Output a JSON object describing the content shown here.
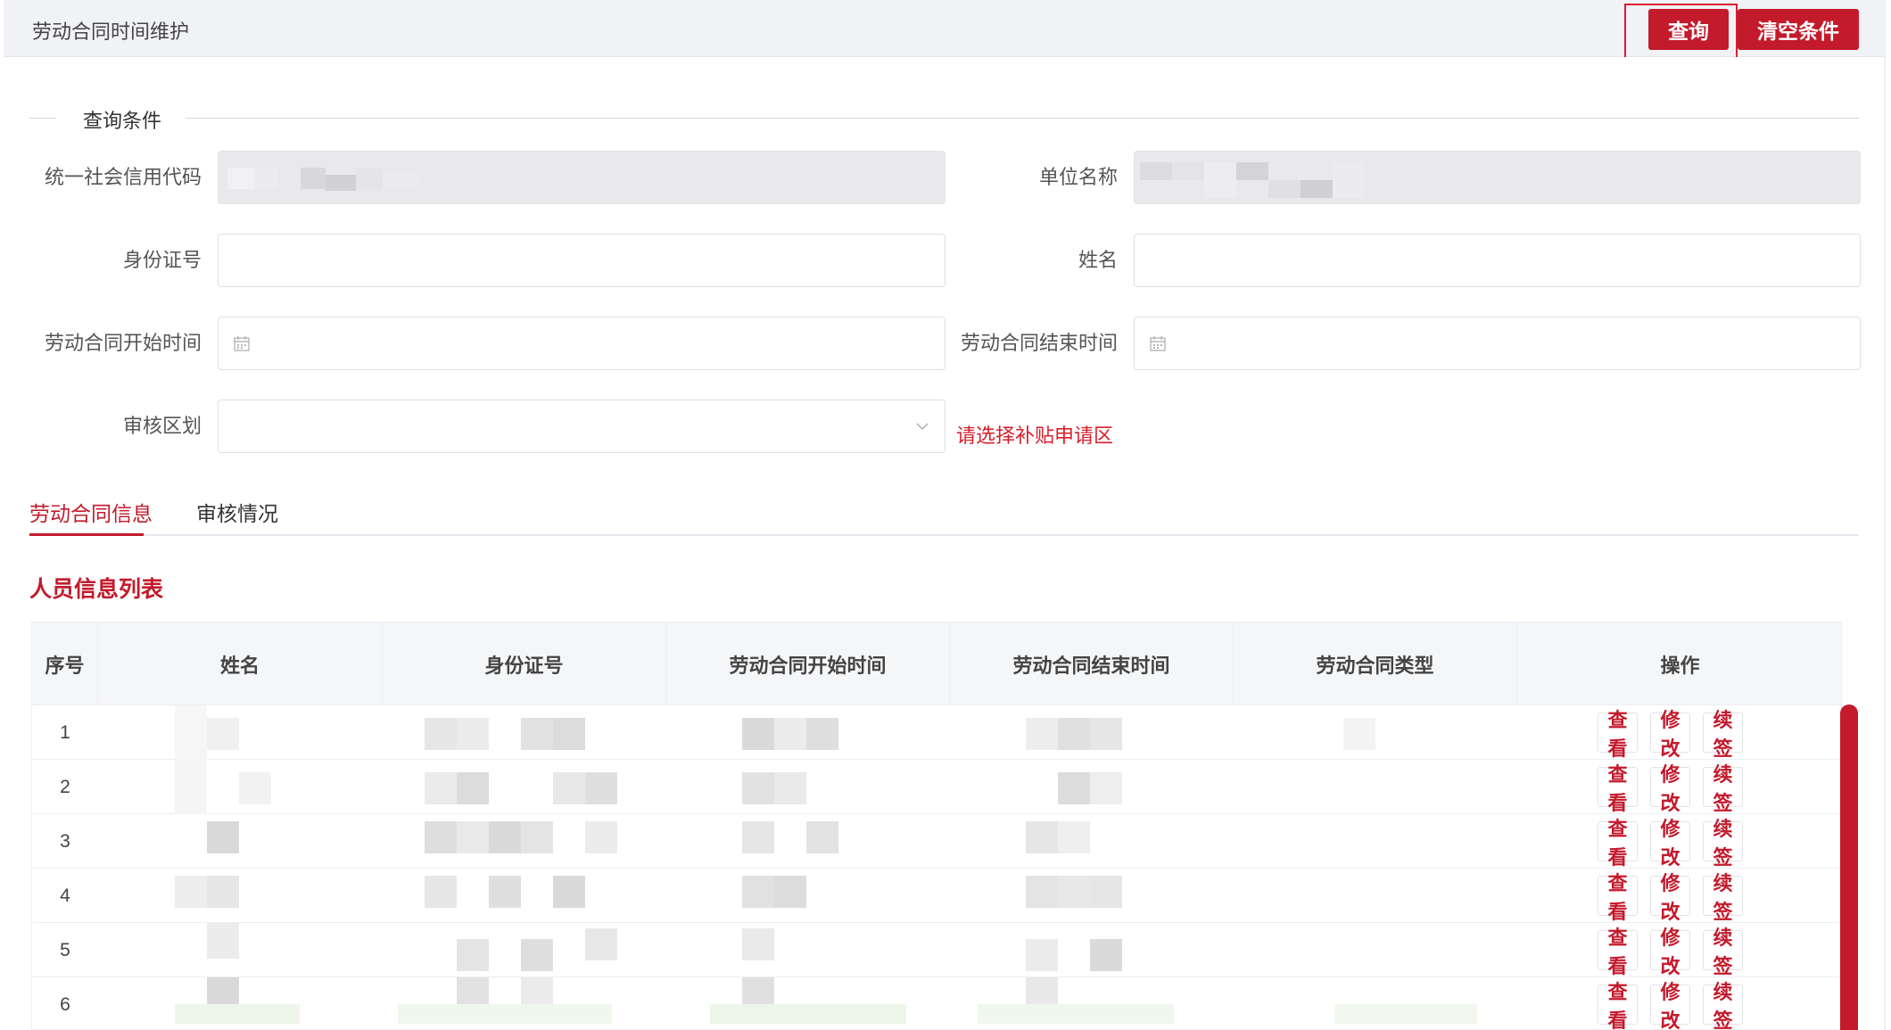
{
  "header": {
    "title": "劳动合同时间维护",
    "query_button": "查询",
    "clear_button": "清空条件"
  },
  "query": {
    "legend": "查询条件",
    "fields": {
      "credit_code_label": "统一社会信用代码",
      "unit_name_label": "单位名称",
      "id_number_label": "身份证号",
      "name_label": "姓名",
      "start_time_label": "劳动合同开始时间",
      "end_time_label": "劳动合同结束时间",
      "region_label": "审核区划",
      "region_hint": "请选择补贴申请区"
    },
    "icons": {
      "calendar": "calendar-icon",
      "select": "chevron-down-icon"
    }
  },
  "tabs": [
    {
      "label": "劳动合同信息",
      "active": true
    },
    {
      "label": "审核情况",
      "active": false
    }
  ],
  "list": {
    "title": "人员信息列表",
    "columns": [
      "序号",
      "姓名",
      "身份证号",
      "劳动合同开始时间",
      "劳动合同结束时间",
      "劳动合同类型",
      "操作"
    ],
    "rows": [
      {
        "no": "1"
      },
      {
        "no": "2"
      },
      {
        "no": "3"
      },
      {
        "no": "4"
      },
      {
        "no": "5"
      },
      {
        "no": "6"
      }
    ],
    "actions": [
      "查看",
      "修改",
      "续签"
    ]
  },
  "colors": {
    "accent": "#c31a2c",
    "header_bg": "#f1f2f6",
    "disabled_bg": "#e9e9eb"
  }
}
